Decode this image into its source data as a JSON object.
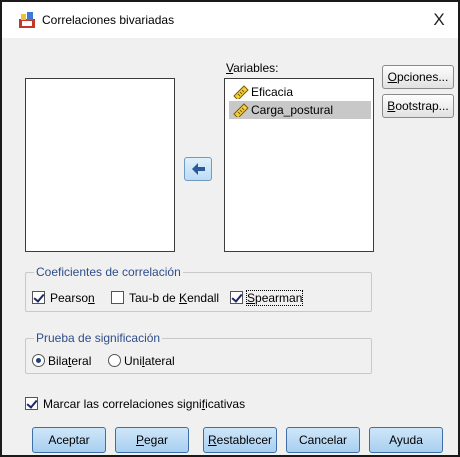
{
  "window": {
    "title": "Correlaciones bivariadas",
    "close_glyph": "X"
  },
  "source_list": {
    "items": []
  },
  "variables": {
    "label": "Variables:",
    "items": [
      {
        "name": "Eficacia",
        "icon": "scale-ruler-icon",
        "selected": false
      },
      {
        "name": "Carga_postural",
        "icon": "scale-ruler-icon",
        "selected": true
      }
    ]
  },
  "buttons": {
    "options": "Opciones...",
    "bootstrap": "Bootstrap...",
    "accept": "Aceptar",
    "paste": "Pegar",
    "reset": "Restablecer",
    "cancel": "Cancelar",
    "help": "Ayuda"
  },
  "coefficients": {
    "title": "Coeficientes de correlación",
    "pearson": {
      "label": "Pearson",
      "checked": true
    },
    "kendall": {
      "label": "Tau-b de Kendall",
      "checked": false
    },
    "spearman": {
      "label": "Spearman",
      "checked": true
    }
  },
  "significance": {
    "title": "Prueba de significación",
    "two_tailed": {
      "label": "Bilateral",
      "selected": true
    },
    "one_tailed": {
      "label": "Unilateral",
      "selected": false
    }
  },
  "flag_significant": {
    "label": "Marcar las correlaciones significativas",
    "checked": true
  },
  "colors": {
    "accent_button": "#a8cff0",
    "selection": "#c8c8c8",
    "group_title": "#2f4d8a"
  }
}
